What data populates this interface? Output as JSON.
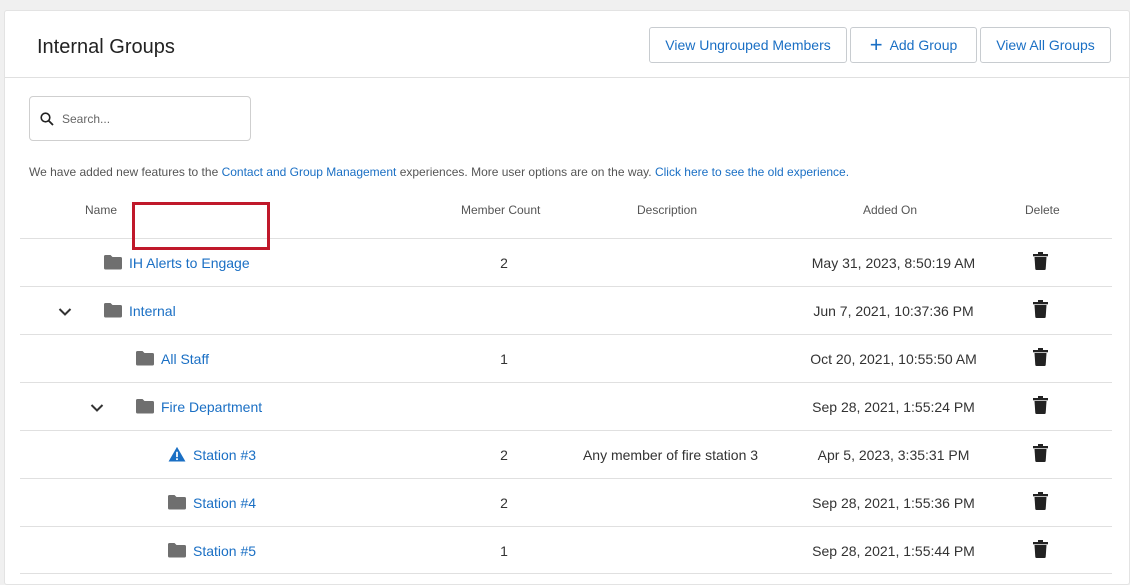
{
  "header": {
    "title": "Internal Groups",
    "btn_ungrouped": "View Ungrouped Members",
    "btn_add_group": "Add Group",
    "btn_view_all": "View All Groups"
  },
  "search": {
    "placeholder": "Search..."
  },
  "notice": {
    "prefix": "We have added new features to the ",
    "link1": "Contact and Group Management",
    "middle": " experiences. More user options are on the way. ",
    "link2": "Click here to see the old experience."
  },
  "columns": {
    "name": "Name",
    "member_count": "Member Count",
    "description": "Description",
    "added_on": "Added On",
    "delete": "Delete"
  },
  "rows": [
    {
      "name": "IH Alerts to Engage",
      "count": "2",
      "description": "",
      "added_on": "May 31, 2023, 8:50:19 AM",
      "icon": "folder-icon",
      "expandable": false,
      "depth": 0
    },
    {
      "name": "Internal",
      "count": "",
      "description": "",
      "added_on": "Jun 7, 2021, 10:37:36 PM",
      "icon": "folder-icon",
      "expandable": true,
      "depth": 0
    },
    {
      "name": "All Staff",
      "count": "1",
      "description": "",
      "added_on": "Oct 20, 2021, 10:55:50 AM",
      "icon": "folder-icon",
      "expandable": false,
      "depth": 1
    },
    {
      "name": "Fire Department",
      "count": "",
      "description": "",
      "added_on": "Sep 28, 2021, 1:55:24 PM",
      "icon": "folder-icon",
      "expandable": true,
      "depth": 1
    },
    {
      "name": "Station #3",
      "count": "2",
      "description": "Any member of fire station 3",
      "added_on": "Apr 5, 2023, 3:35:31 PM",
      "icon": "warning-icon",
      "expandable": false,
      "depth": 2
    },
    {
      "name": "Station #4",
      "count": "2",
      "description": "",
      "added_on": "Sep 28, 2021, 1:55:36 PM",
      "icon": "folder-icon",
      "expandable": false,
      "depth": 2
    },
    {
      "name": "Station #5",
      "count": "1",
      "description": "",
      "added_on": "Sep 28, 2021, 1:55:44 PM",
      "icon": "folder-icon",
      "expandable": false,
      "depth": 2
    }
  ],
  "colors": {
    "link": "#1a6fc4",
    "highlight": "#c0182a",
    "folder": "#6f6f6f"
  }
}
